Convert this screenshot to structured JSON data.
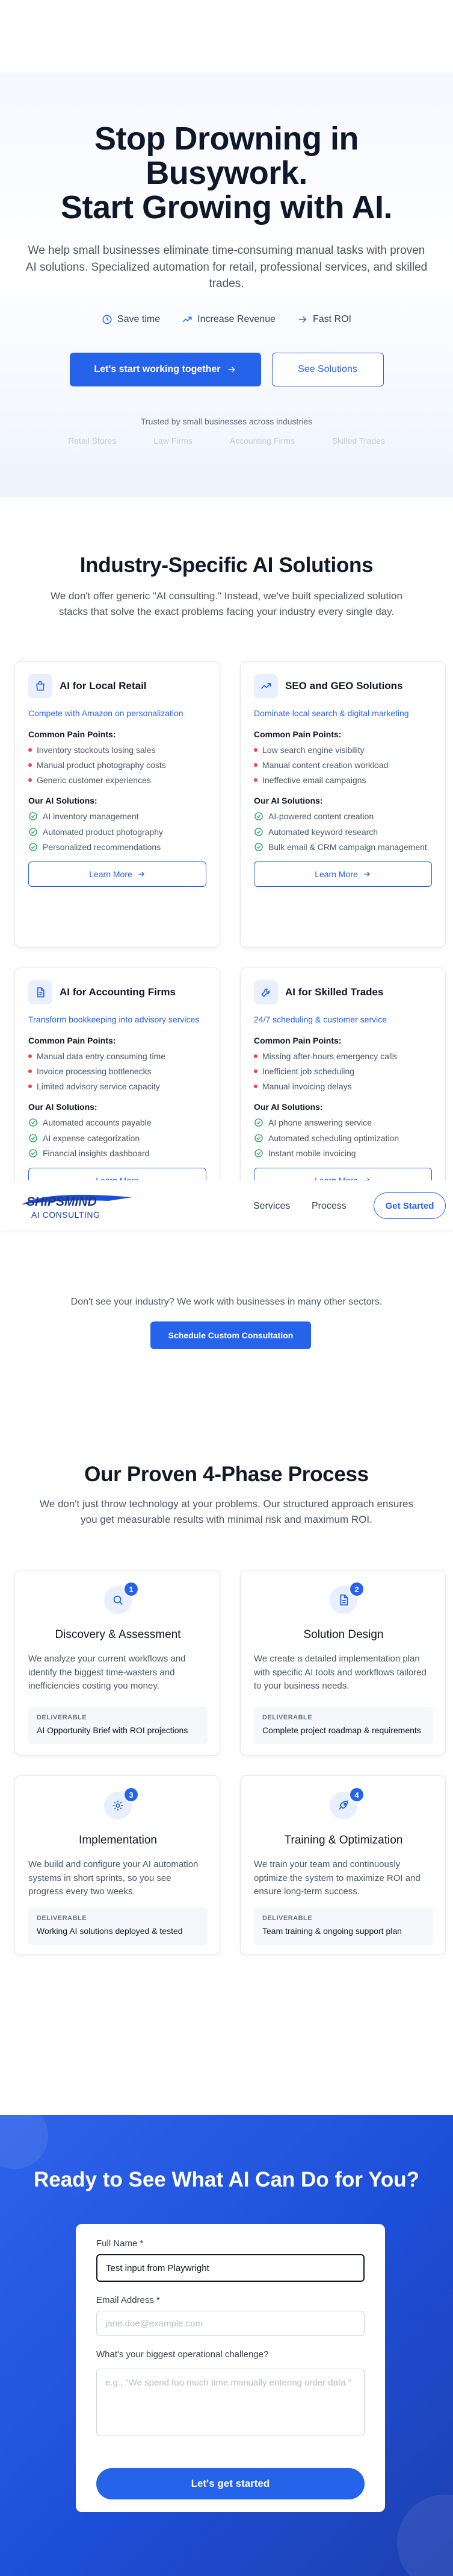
{
  "hero": {
    "title_lines": [
      "Stop Drowning in",
      "Busywork.",
      "Start Growing with AI."
    ],
    "subtitle": "We help small businesses eliminate time-consuming manual tasks with proven AI solutions. Specialized automation for retail, professional services, and skilled trades.",
    "benefits": [
      {
        "icon": "clock-icon",
        "label": "Save time"
      },
      {
        "icon": "trend-up-icon",
        "label": "Increase Revenue"
      },
      {
        "icon": "arrow-right-icon",
        "label": "Fast ROI"
      }
    ],
    "primary_cta": "Let's start working together",
    "secondary_cta": "See Solutions",
    "trusted_text": "Trusted by small businesses across industries",
    "industries": [
      "Retail Stores",
      "Law Firms",
      "Accounting Firms",
      "Skilled Trades"
    ]
  },
  "solutions": {
    "title": "Industry-Specific AI Solutions",
    "subtitle": "We don't offer generic \"AI consulting.\" Instead, we've built specialized solution stacks that solve the exact problems facing your industry every single day.",
    "pain_heading": "Common Pain Points:",
    "solutions_heading": "Our AI Solutions:",
    "learn_more": "Learn More",
    "cards": [
      {
        "icon": "shopping-bag-icon",
        "title": "AI for Local Retail",
        "tagline": "Compete with Amazon on personalization",
        "pains": [
          "Inventory stockouts losing sales",
          "Manual product photography costs",
          "Generic customer experiences"
        ],
        "solutions": [
          "AI inventory management",
          "Automated product photography",
          "Personalized recommendations"
        ]
      },
      {
        "icon": "trend-up-icon",
        "title": "SEO and GEO Solutions",
        "tagline": "Dominate local search & digital marketing",
        "pains": [
          "Low search engine visibility",
          "Manual content creation workload",
          "Ineffective email campaigns"
        ],
        "solutions": [
          "AI-powered content creation",
          "Automated keyword research",
          "Bulk email & CRM campaign management"
        ]
      },
      {
        "icon": "document-icon",
        "title": "AI for Accounting Firms",
        "tagline": "Transform bookkeeping into advisory services",
        "pains": [
          "Manual data entry consuming time",
          "Invoice processing bottlenecks",
          "Limited advisory service capacity"
        ],
        "solutions": [
          "Automated accounts payable",
          "AI expense categorization",
          "Financial insights dashboard"
        ]
      },
      {
        "icon": "wrench-icon",
        "title": "AI for Skilled Trades",
        "tagline": "24/7 scheduling & customer service",
        "pains": [
          "Missing after-hours emergency calls",
          "Inefficient job scheduling",
          "Manual invoicing delays"
        ],
        "solutions": [
          "AI phone answering service",
          "Automated scheduling optimization",
          "Instant mobile invoicing"
        ]
      }
    ],
    "other_text": "Don't see your industry? We work with businesses in many other sectors.",
    "custom_cta": "Schedule Custom Consultation"
  },
  "nav": {
    "logo_text": "SHIPSMIND",
    "logo_sub": "AI CONSULTING",
    "links": [
      "Services",
      "Process"
    ],
    "cta": "Get Started"
  },
  "process": {
    "title": "Our Proven 4-Phase Process",
    "subtitle": "We don't just throw technology at your problems. Our structured approach ensures you get measurable results with minimal risk and maximum ROI.",
    "deliverable_label": "DELIVERABLE",
    "phases": [
      {
        "num": "1",
        "icon": "search-icon",
        "title": "Discovery & Assessment",
        "desc": "We analyze your current workflows and identify the biggest time-wasters and inefficiencies costing you money.",
        "deliverable": "AI Opportunity Brief with ROI projections"
      },
      {
        "num": "2",
        "icon": "document-icon",
        "title": "Solution Design",
        "desc": "We create a detailed implementation plan with specific AI tools and workflows tailored to your business needs.",
        "deliverable": "Complete project roadmap & requirements"
      },
      {
        "num": "3",
        "icon": "gear-icon",
        "title": "Implementation",
        "desc": "We build and configure your AI automation systems in short sprints, so you see progress every two weeks.",
        "deliverable": "Working AI solutions deployed & tested"
      },
      {
        "num": "4",
        "icon": "rocket-icon",
        "title": "Training & Optimization",
        "desc": "We train your team and continuously optimize the system to maximize ROI and ensure long-term success.",
        "deliverable": "Team training & ongoing support plan"
      }
    ]
  },
  "cta": {
    "title": "Ready to See What AI Can Do for You?",
    "name_label": "Full Name *",
    "name_value": "Test input from Playwright",
    "email_label": "Email Address *",
    "email_placeholder": "jane.doe@example.com",
    "challenge_label": "What's your biggest operational challenge?",
    "challenge_placeholder": "e.g., \"We spend too much time manually entering order data.\"",
    "submit": "Let's get started"
  },
  "colors": {
    "accent": "#2563eb",
    "pain": "#ef4444",
    "check": "#16a34a"
  }
}
